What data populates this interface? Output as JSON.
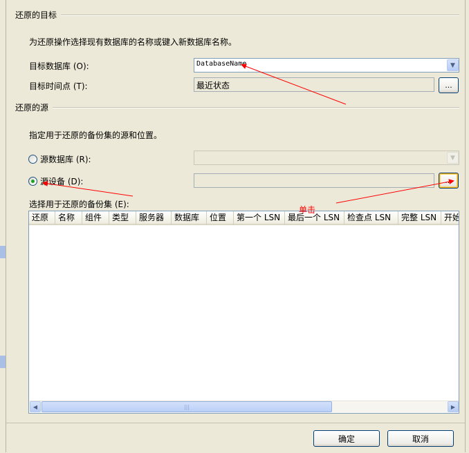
{
  "target_group": {
    "title": "还原的目标",
    "description": "为还原操作选择现有数据库的名称或键入新数据库名称。",
    "database_label": "目标数据库 (O):",
    "database_value": "DatabaseName",
    "time_label": "目标时间点 (T):",
    "time_value": "最近状态",
    "browse_label": "..."
  },
  "source_group": {
    "title": "还原的源",
    "description": "指定用于还原的备份集的源和位置。",
    "source_db_label": "源数据库 (R):",
    "source_device_label": "源设备 (D):",
    "source_device_selected": true,
    "browse_label": "..."
  },
  "backup_sets": {
    "label": "选择用于还原的备份集 (E):",
    "columns": [
      "还原",
      "名称",
      "组件",
      "类型",
      "服务器",
      "数据库",
      "位置",
      "第一个 LSN",
      "最后一个 LSN",
      "检查点 LSN",
      "完整 LSN",
      "开始"
    ],
    "scroll_grip": "|||"
  },
  "buttons": {
    "ok": "确定",
    "cancel": "取消"
  },
  "annotation": {
    "click_text": "单击",
    "color": "#ff0000"
  }
}
